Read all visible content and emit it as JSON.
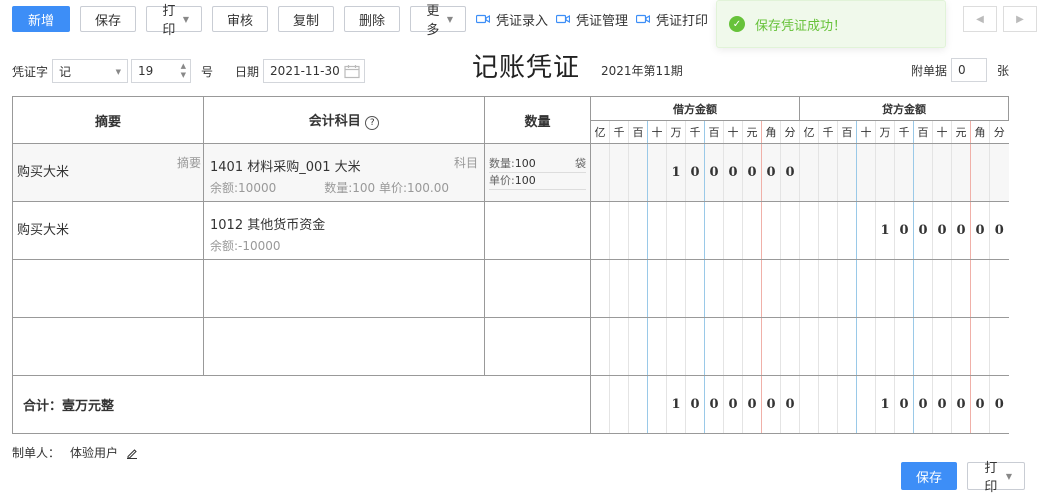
{
  "toolbar": {
    "add": "新增",
    "save": "保存",
    "print": "打印",
    "audit": "审核",
    "copy": "复制",
    "delete": "删除",
    "more": "更多",
    "entry": "凭证录入",
    "manage": "凭证管理",
    "print_link": "凭证打印"
  },
  "toast": {
    "message": "保存凭证成功！",
    "color": "#67c23a"
  },
  "meta": {
    "word_label": "凭证字",
    "word_value": "记",
    "number_value": "19",
    "number_unit": "号",
    "date_label": "日期",
    "date_value": "2021-11-30",
    "title": "记账凭证",
    "period": "2021年第11期",
    "attach_label": "附单据",
    "attach_value": "0",
    "attach_unit": "张"
  },
  "table": {
    "headers": {
      "summary": "摘要",
      "subject": "会计科目",
      "quantity": "数量",
      "debit": "借方金额",
      "credit": "贷方金额"
    },
    "units": [
      "亿",
      "千",
      "百",
      "十",
      "万",
      "千",
      "百",
      "十",
      "元",
      "角",
      "分"
    ],
    "rows": [
      {
        "summary": "购买大米",
        "summary_hint": "摘要",
        "subject": "1401 材料采购_001 大米",
        "subject_hint": "科目",
        "balance": "余额:10000",
        "qty_info": "数量:100 单价:100.00",
        "qty_label": "数量:",
        "qty_value": "100",
        "qty_unit": "袋",
        "price_label": "单价:",
        "price_value": "100",
        "debit": [
          "",
          "",
          "",
          "",
          "1",
          "0",
          "0",
          "0",
          "0",
          "0",
          "0"
        ],
        "credit": [
          "",
          "",
          "",
          "",
          "",
          "",
          "",
          "",
          "",
          "",
          ""
        ]
      },
      {
        "summary": "购买大米",
        "subject": "1012 其他货币资金",
        "balance": "余额:-10000",
        "debit": [
          "",
          "",
          "",
          "",
          "",
          "",
          "",
          "",
          "",
          "",
          ""
        ],
        "credit": [
          "",
          "",
          "",
          "",
          "1",
          "0",
          "0",
          "0",
          "0",
          "0",
          "0"
        ]
      }
    ],
    "total_label": "合计：壹万元整",
    "total_debit": [
      "",
      "",
      "",
      "",
      "1",
      "0",
      "0",
      "0",
      "0",
      "0",
      "0"
    ],
    "total_credit": [
      "",
      "",
      "",
      "",
      "1",
      "0",
      "0",
      "0",
      "0",
      "0",
      "0"
    ]
  },
  "footer": {
    "maker_label": "制单人：",
    "maker_value": "体验用户",
    "save": "保存",
    "print": "打印"
  },
  "colors": {
    "accent": "#3d8ef7"
  }
}
